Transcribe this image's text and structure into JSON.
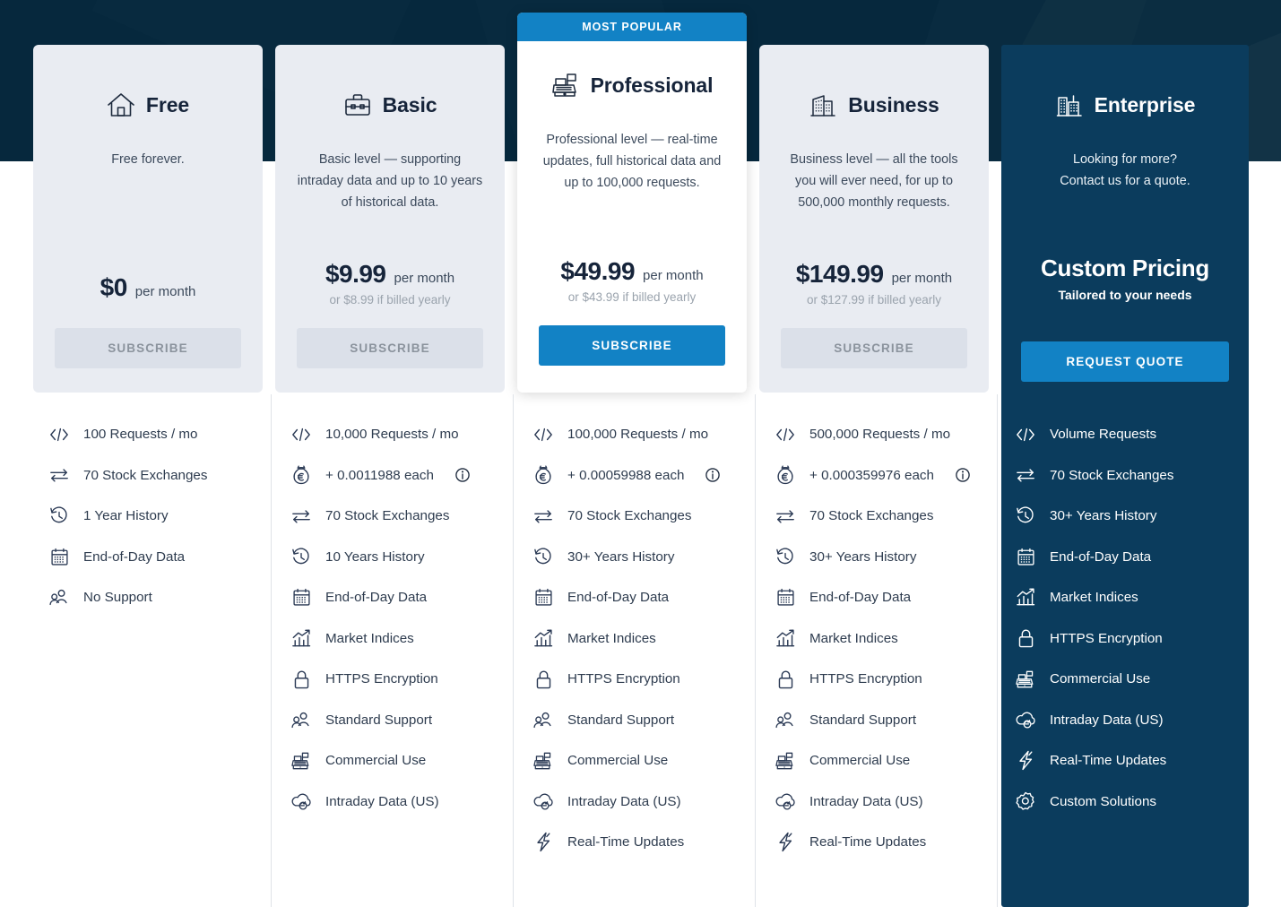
{
  "banner": {
    "label": "MOST POPULAR"
  },
  "colors": {
    "hero_background": "#06283d",
    "card_background": "#e9ecf2",
    "popular_card_background": "#ffffff",
    "enterprise_background": "#0b3c5d",
    "accent_blue": "#1282c5",
    "disabled_button": "#dbe0e9",
    "disabled_button_text": "#8b939d",
    "divider": "#dfe3e8",
    "muted_text": "#9aa3ad"
  },
  "plans": [
    {
      "id": "free",
      "name": "Free",
      "icon": "home-icon",
      "description": "Free forever.",
      "price_amount": "$0",
      "price_period": "per month",
      "price_yearly": "",
      "cta_label": "SUBSCRIBE",
      "cta_style": "disabled",
      "features": [
        {
          "icon": "code-icon",
          "label": "100 Requests / mo"
        },
        {
          "icon": "exchange-icon",
          "label": "70 Stock Exchanges"
        },
        {
          "icon": "history-clock-icon",
          "label": "1 Year History"
        },
        {
          "icon": "calendar-icon",
          "label": "End-of-Day Data"
        },
        {
          "icon": "users-icon",
          "label": "No Support"
        }
      ]
    },
    {
      "id": "basic",
      "name": "Basic",
      "icon": "briefcase-icon",
      "description": "Basic level — supporting intraday data and up to 10 years of historical data.",
      "price_amount": "$9.99",
      "price_period": "per month",
      "price_yearly": "or $8.99 if billed yearly",
      "cta_label": "SUBSCRIBE",
      "cta_style": "disabled",
      "features": [
        {
          "icon": "code-icon",
          "label": "10,000 Requests / mo"
        },
        {
          "icon": "money-bag-euro-icon",
          "label": "+ 0.0011988 each",
          "info": true
        },
        {
          "icon": "exchange-icon",
          "label": "70 Stock Exchanges"
        },
        {
          "icon": "history-clock-icon",
          "label": "10 Years History"
        },
        {
          "icon": "calendar-icon",
          "label": "End-of-Day Data"
        },
        {
          "icon": "chart-up-icon",
          "label": "Market Indices"
        },
        {
          "icon": "lock-icon",
          "label": "HTTPS Encryption"
        },
        {
          "icon": "users-icon",
          "label": "Standard Support"
        },
        {
          "icon": "cash-register-icon",
          "label": "Commercial Use"
        },
        {
          "icon": "cloud-refresh-icon",
          "label": "Intraday Data (US)"
        }
      ]
    },
    {
      "id": "professional",
      "name": "Professional",
      "icon": "cash-register-icon",
      "description": "Professional level — real-time updates, full historical data and up to 100,000 requests.",
      "price_amount": "$49.99",
      "price_period": "per month",
      "price_yearly": "or $43.99 if billed yearly",
      "cta_label": "SUBSCRIBE",
      "cta_style": "primary",
      "badge": "MOST POPULAR",
      "features": [
        {
          "icon": "code-icon",
          "label": "100,000 Requests / mo"
        },
        {
          "icon": "money-bag-euro-icon",
          "label": "+ 0.00059988 each",
          "info": true
        },
        {
          "icon": "exchange-icon",
          "label": "70 Stock Exchanges"
        },
        {
          "icon": "history-clock-icon",
          "label": "30+ Years History"
        },
        {
          "icon": "calendar-icon",
          "label": "End-of-Day Data"
        },
        {
          "icon": "chart-up-icon",
          "label": "Market Indices"
        },
        {
          "icon": "lock-icon",
          "label": "HTTPS Encryption"
        },
        {
          "icon": "users-icon",
          "label": "Standard Support"
        },
        {
          "icon": "cash-register-icon",
          "label": "Commercial Use"
        },
        {
          "icon": "cloud-refresh-icon",
          "label": "Intraday Data (US)"
        },
        {
          "icon": "lightning-icon",
          "label": "Real-Time Updates"
        }
      ]
    },
    {
      "id": "business",
      "name": "Business",
      "icon": "office-building-icon",
      "description": "Business level — all the tools you will ever need, for up to 500,000 monthly requests.",
      "price_amount": "$149.99",
      "price_period": "per month",
      "price_yearly": "or $127.99 if billed yearly",
      "cta_label": "SUBSCRIBE",
      "cta_style": "disabled",
      "features": [
        {
          "icon": "code-icon",
          "label": "500,000 Requests / mo"
        },
        {
          "icon": "money-bag-euro-icon",
          "label": "+ 0.000359976 each",
          "info": true
        },
        {
          "icon": "exchange-icon",
          "label": "70 Stock Exchanges"
        },
        {
          "icon": "history-clock-icon",
          "label": "30+ Years History"
        },
        {
          "icon": "calendar-icon",
          "label": "End-of-Day Data"
        },
        {
          "icon": "chart-up-icon",
          "label": "Market Indices"
        },
        {
          "icon": "lock-icon",
          "label": "HTTPS Encryption"
        },
        {
          "icon": "users-icon",
          "label": "Standard Support"
        },
        {
          "icon": "cash-register-icon",
          "label": "Commercial Use"
        },
        {
          "icon": "cloud-refresh-icon",
          "label": "Intraday Data (US)"
        },
        {
          "icon": "lightning-icon",
          "label": "Real-Time Updates"
        }
      ]
    },
    {
      "id": "enterprise",
      "name": "Enterprise",
      "icon": "city-buildings-icon",
      "description": "Looking for more?\nContact us for a quote.",
      "description_line1": "Looking for more?",
      "description_line2": "Contact us for a quote.",
      "price_amount": "Custom Pricing",
      "price_period": "Tailored to your needs",
      "price_yearly": "",
      "cta_label": "REQUEST QUOTE",
      "cta_style": "primary",
      "features": [
        {
          "icon": "code-icon",
          "label": "Volume Requests"
        },
        {
          "icon": "exchange-icon",
          "label": "70 Stock Exchanges"
        },
        {
          "icon": "history-clock-icon",
          "label": "30+ Years History"
        },
        {
          "icon": "calendar-icon",
          "label": "End-of-Day Data"
        },
        {
          "icon": "chart-up-icon",
          "label": "Market Indices"
        },
        {
          "icon": "lock-icon",
          "label": "HTTPS Encryption"
        },
        {
          "icon": "cash-register-icon",
          "label": "Commercial Use"
        },
        {
          "icon": "cloud-refresh-icon",
          "label": "Intraday Data (US)"
        },
        {
          "icon": "lightning-icon",
          "label": "Real-Time Updates"
        },
        {
          "icon": "gear-icon",
          "label": "Custom Solutions"
        }
      ]
    }
  ]
}
